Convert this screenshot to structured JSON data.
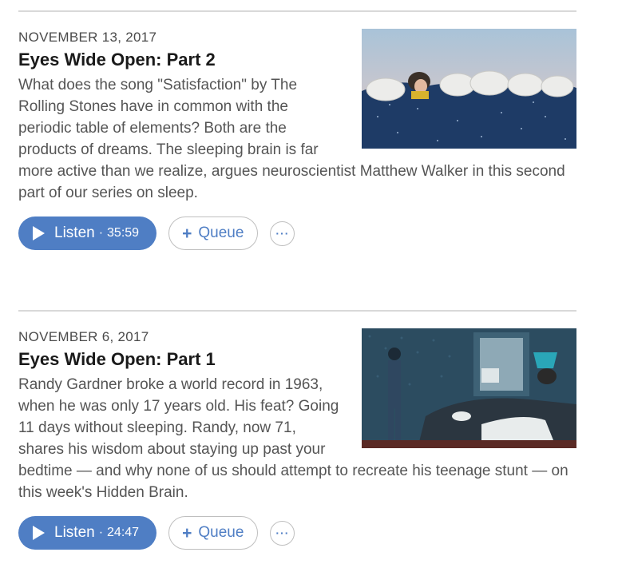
{
  "episodes": [
    {
      "date": "NOVEMBER 13, 2017",
      "title": "Eyes Wide Open: Part 2",
      "description": "What does the song \"Satisfaction\" by The Rolling Stones have in common with the periodic table of elements? Both are the products of dreams. The sleeping brain is far more active than we realize, argues neuroscientist Matthew Walker in this second part of our series on sleep.",
      "listen_label": "Listen",
      "separator": "·",
      "duration": "35:59",
      "queue_plus": "+",
      "queue_label": "Queue",
      "more_label": "···",
      "image_icon": "sleeping-sheep-illustration"
    },
    {
      "date": "NOVEMBER 6, 2017",
      "title": "Eyes Wide Open: Part 1",
      "description": "Randy Gardner broke a world record in 1963, when he was only 17 years old. His feat? Going 11 days without sleeping. Randy, now 71, shares his wisdom about staying up past your bedtime — and why none of us should attempt to recreate his teenage stunt — on this week's Hidden Brain.",
      "listen_label": "Listen",
      "separator": "·",
      "duration": "24:47",
      "queue_plus": "+",
      "queue_label": "Queue",
      "more_label": "···",
      "image_icon": "sleepless-bedroom-illustration"
    }
  ],
  "colors": {
    "accent": "#4f7ec4",
    "title": "#1a1a1a",
    "text": "#555555",
    "divider": "#d9d9d9"
  }
}
